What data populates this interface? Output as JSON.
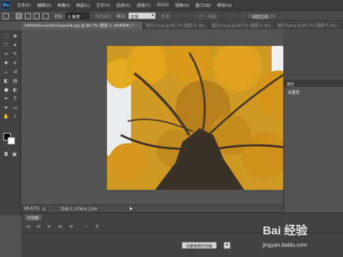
{
  "app": {
    "logo": "Ps"
  },
  "menu": [
    "文件(F)",
    "编辑(E)",
    "图像(I)",
    "图层(L)",
    "文字(Y)",
    "选择(S)",
    "滤镜(T)",
    "3D(D)",
    "视图(V)",
    "窗口(W)",
    "帮助(H)"
  ],
  "options": {
    "feather_label": "羽化:",
    "feather_value": "0 像素",
    "antialias_label": "消除锯齿",
    "style_label": "样式:",
    "style_value": "正常",
    "width_label": "宽度:",
    "height_label": "高度:",
    "refine_button": "调整边缘..."
  },
  "tabs": [
    {
      "label": "194924mruxr4x7xxztszr4.jpg @ 66.7% (图层 2, RGB/8#) *",
      "active": true
    },
    {
      "label": "图片1.png @ 66.7% (图层 0, RG...",
      "active": false
    },
    {
      "label": "图片2.png @ 66.7% (图层 0, RG...",
      "active": false
    },
    {
      "label": "图片3.png @ 66.7% (图层 0, RG...",
      "active": false
    }
  ],
  "tools": [
    {
      "name": "marquee-tool-icon",
      "glyph": "⬚"
    },
    {
      "name": "move-tool-icon",
      "glyph": "✥"
    },
    {
      "name": "lasso-tool-icon",
      "glyph": "➰"
    },
    {
      "name": "magic-wand-tool-icon",
      "glyph": "✦"
    },
    {
      "name": "crop-tool-icon",
      "glyph": "⌗"
    },
    {
      "name": "eyedropper-tool-icon",
      "glyph": "✎"
    },
    {
      "name": "healing-brush-tool-icon",
      "glyph": "✚"
    },
    {
      "name": "brush-tool-icon",
      "glyph": "✐"
    },
    {
      "name": "clone-stamp-tool-icon",
      "glyph": "⊥"
    },
    {
      "name": "history-brush-tool-icon",
      "glyph": "↺"
    },
    {
      "name": "eraser-tool-icon",
      "glyph": "◧"
    },
    {
      "name": "gradient-tool-icon",
      "glyph": "▤"
    },
    {
      "name": "blur-tool-icon",
      "glyph": "●"
    },
    {
      "name": "dodge-tool-icon",
      "glyph": "◐"
    },
    {
      "name": "pen-tool-icon",
      "glyph": "✒"
    },
    {
      "name": "type-tool-icon",
      "glyph": "T"
    },
    {
      "name": "path-selection-tool-icon",
      "glyph": "➤"
    },
    {
      "name": "shape-tool-icon",
      "glyph": "▭"
    },
    {
      "name": "hand-tool-icon",
      "glyph": "✋"
    },
    {
      "name": "zoom-tool-icon",
      "glyph": "⌕"
    }
  ],
  "status": {
    "zoom": "66.67%",
    "doc_info": "文档:1.37M/4.12M"
  },
  "properties": {
    "title": "属性",
    "content": "无属性"
  },
  "timeline": {
    "tab": "时间轴",
    "create_button": "创建视频时间轴"
  },
  "watermark": {
    "logo": "Bai 经验",
    "url": "jingyan.baidu.com"
  },
  "colors": {
    "foreground": "#000000",
    "background": "#ffffff",
    "ui_dark": "#3c3c3c",
    "foliage": "#d9a12a"
  }
}
